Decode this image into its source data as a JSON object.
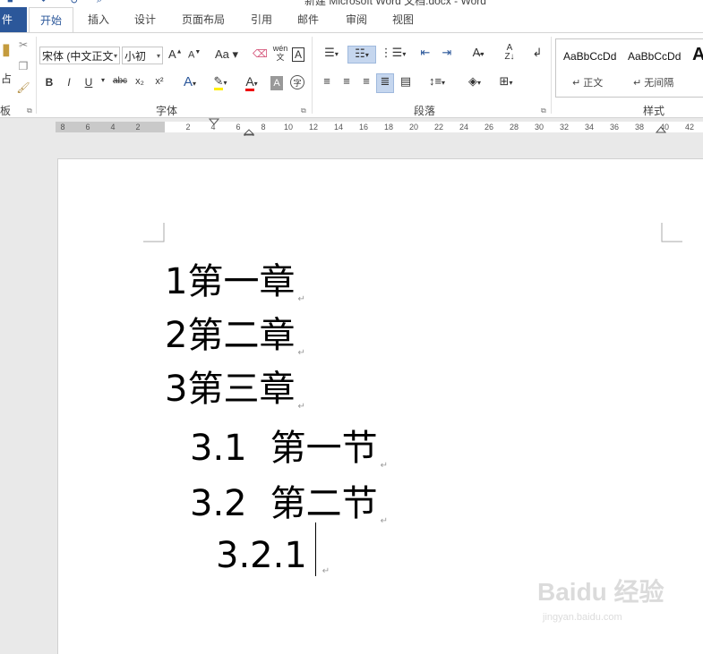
{
  "window": {
    "title": "新建 Microsoft Word 文档.docx - Word"
  },
  "tabs": [
    {
      "label": "件"
    },
    {
      "label": "开始"
    },
    {
      "label": "插入"
    },
    {
      "label": "设计"
    },
    {
      "label": "页面布局"
    },
    {
      "label": "引用"
    },
    {
      "label": "邮件"
    },
    {
      "label": "审阅"
    },
    {
      "label": "视图"
    }
  ],
  "ribbon": {
    "clipboard": {
      "paste_label": "占",
      "group_label": "板"
    },
    "font": {
      "font_name": "宋体 (中文正文",
      "font_size": "小初",
      "group_label": "字体",
      "bold": "B",
      "italic": "I",
      "underline": "U",
      "strike": "abc",
      "subscript": "x₂",
      "superscript": "x²",
      "case": "Aa",
      "grow": "A",
      "shrink": "A",
      "phonetic": "wén 文",
      "border_char": "A"
    },
    "paragraph": {
      "group_label": "段落"
    },
    "styles": {
      "group_label": "样式",
      "items": [
        {
          "preview": "AaBbCcDd",
          "name": "↵ 正文"
        },
        {
          "preview": "AaBbCcDd",
          "name": "↵ 无间隔"
        },
        {
          "preview": "A",
          "name": ""
        }
      ]
    }
  },
  "ruler": {
    "labels": [
      "8",
      "6",
      "4",
      "2",
      "",
      "2",
      "4",
      "6",
      "8",
      "10",
      "12",
      "14",
      "16",
      "18",
      "20",
      "22",
      "24",
      "26",
      "28",
      "30",
      "32",
      "34",
      "36",
      "38",
      "40",
      "42"
    ]
  },
  "document": {
    "headings": [
      {
        "number": "1",
        "text": "第一章"
      },
      {
        "number": "2",
        "text": "第二章"
      },
      {
        "number": "3",
        "text": "第三章"
      },
      {
        "number": "3.1",
        "text": "第一节"
      },
      {
        "number": "3.2",
        "text": "第二节"
      },
      {
        "number": "3.2.1",
        "text": ""
      }
    ],
    "paragraph_mark": "↵"
  },
  "watermark": {
    "brand": "Baidu 经验",
    "url": "jingyan.baidu.com"
  }
}
